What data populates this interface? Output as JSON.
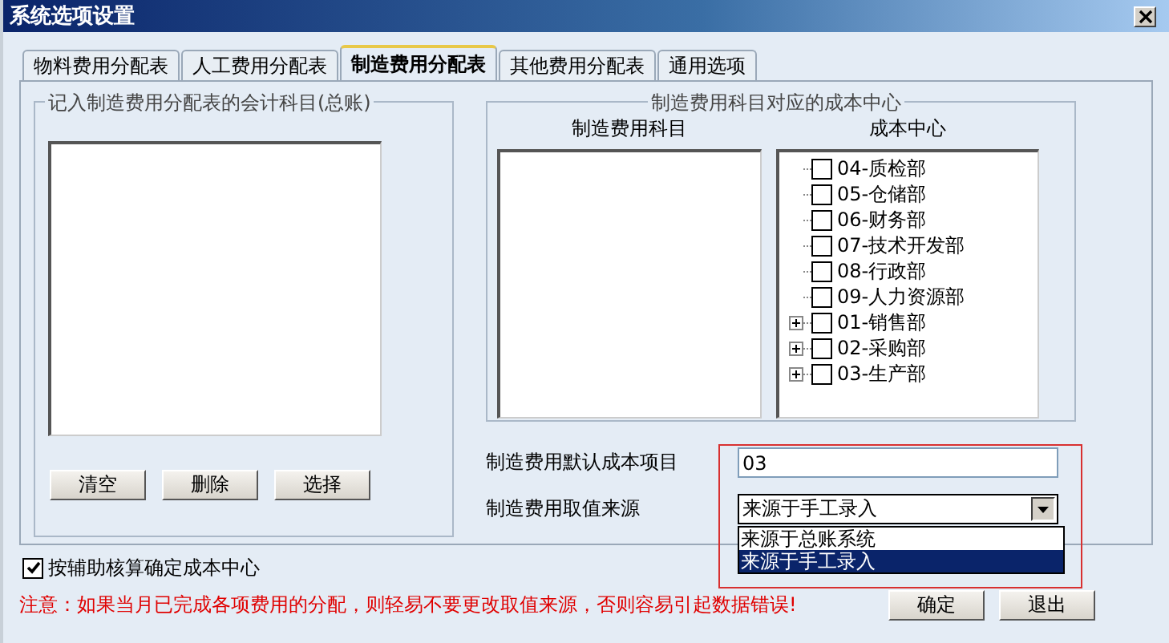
{
  "window": {
    "title": "系统选项设置"
  },
  "tabs": [
    {
      "label": "物料费用分配表",
      "selected": false
    },
    {
      "label": "人工费用分配表",
      "selected": false
    },
    {
      "label": "制造费用分配表",
      "selected": true
    },
    {
      "label": "其他费用分配表",
      "selected": false
    },
    {
      "label": "通用选项",
      "selected": false
    }
  ],
  "account_group": {
    "title": "记入制造费用分配表的会计科目(总账)",
    "buttons": [
      "清空",
      "删除",
      "选择"
    ]
  },
  "cost_center_group": {
    "title": "制造费用科目对应的成本中心",
    "expense_list": {
      "header": "制造费用科目"
    },
    "tree": {
      "header": "成本中心",
      "items": [
        {
          "label": "04-质检部",
          "checked": false,
          "has_children": false
        },
        {
          "label": "05-仓储部",
          "checked": false,
          "has_children": false
        },
        {
          "label": "06-财务部",
          "checked": false,
          "has_children": false
        },
        {
          "label": "07-技术开发部",
          "checked": false,
          "has_children": false
        },
        {
          "label": "08-行政部",
          "checked": false,
          "has_children": false
        },
        {
          "label": "09-人力资源部",
          "checked": false,
          "has_children": false
        },
        {
          "label": "01-销售部",
          "checked": false,
          "has_children": true
        },
        {
          "label": "02-采购部",
          "checked": false,
          "has_children": true
        },
        {
          "label": "03-生产部",
          "checked": false,
          "has_children": true
        }
      ]
    }
  },
  "default_cost_item": {
    "label": "制造费用默认成本项目",
    "value": "03"
  },
  "value_source": {
    "label": "制造费用取值来源",
    "value": "来源于手工录入",
    "expanded": true,
    "options": [
      {
        "label": "来源于总账系统",
        "selected": false
      },
      {
        "label": "来源于手工录入",
        "selected": true
      }
    ]
  },
  "confirm_by_aux": {
    "label": "按辅助核算确定成本中心",
    "checked": true
  },
  "warning": "注意：如果当月已完成各项费用的分配，则轻易不要更改取值来源，否则容易引起数据错误!",
  "buttons": [
    "确定",
    "退出"
  ]
}
